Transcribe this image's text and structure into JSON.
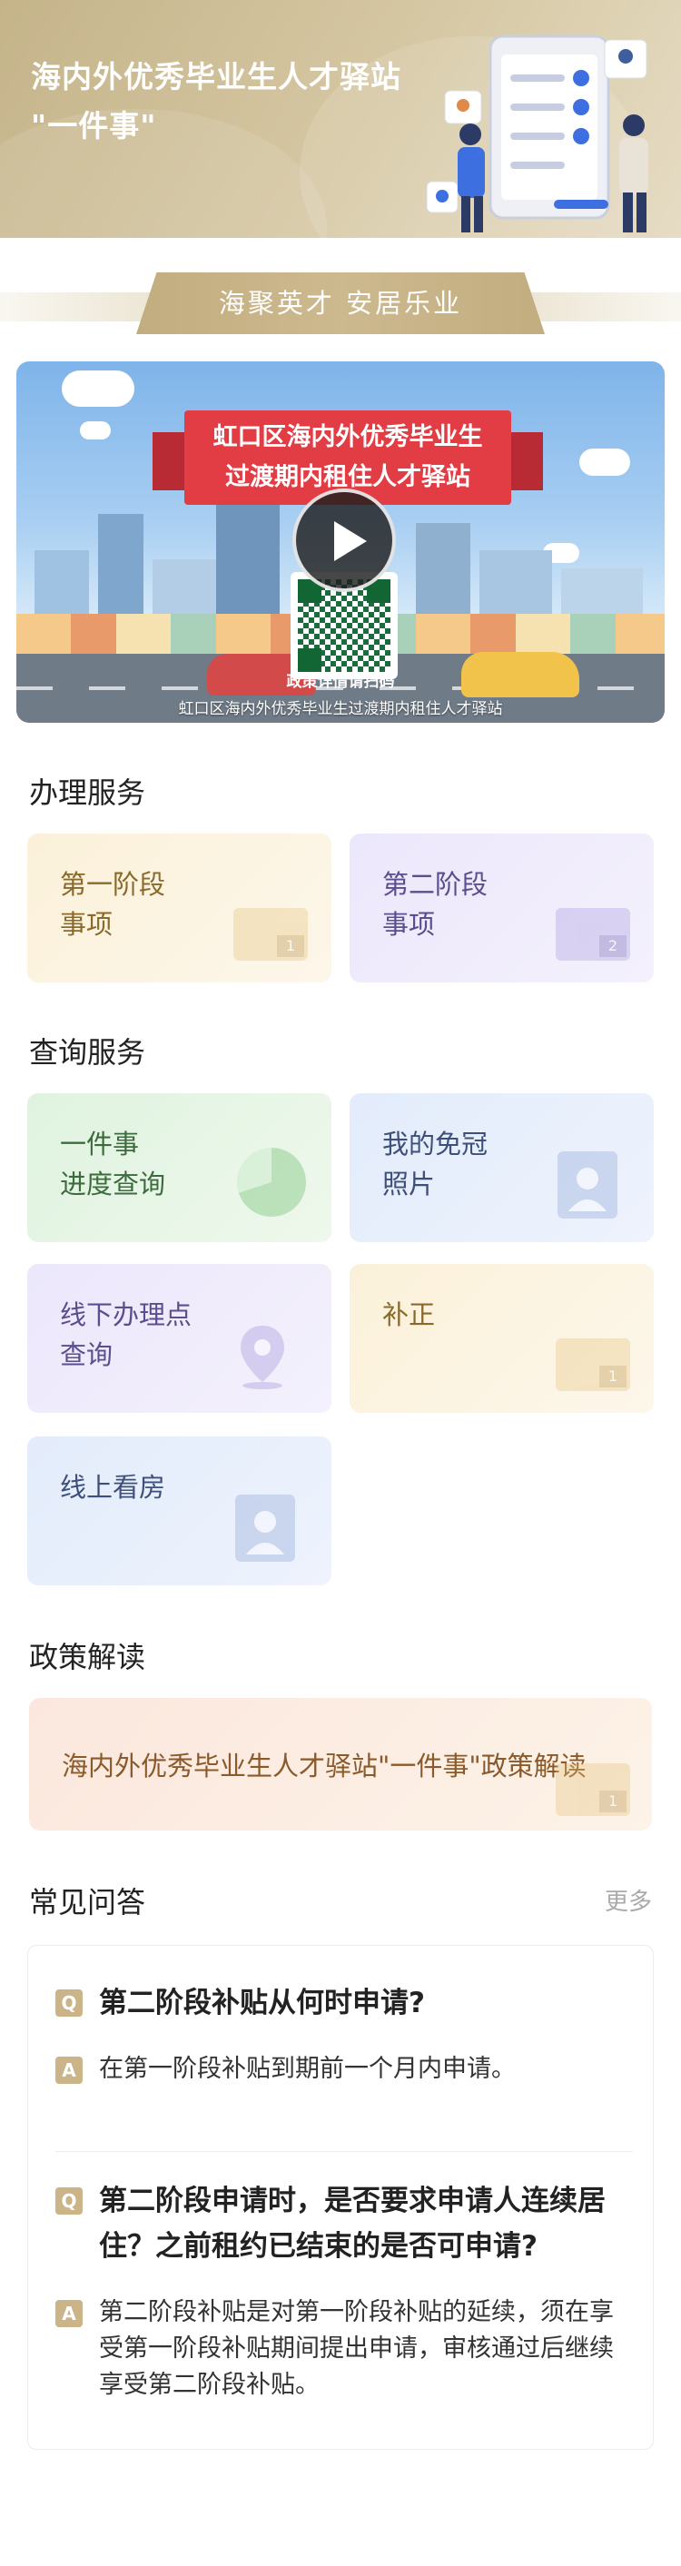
{
  "hero": {
    "title": "海内外优秀毕业生人才驿站\n\"一件事\""
  },
  "slogan": "海聚英才  安居乐业",
  "video": {
    "banner_line1": "虹口区海内外优秀毕业生",
    "banner_line2": "过渡期内租住人才驿站",
    "qr_caption": "政策详情请扫码",
    "caption": "虹口区海内外优秀毕业生过渡期内租住人才驿站"
  },
  "sections": {
    "handle_title": "办理服务",
    "query_title": "查询服务",
    "policy_title": "政策解读",
    "faq_title": "常见问答",
    "faq_more": "更多"
  },
  "handle_cards": [
    {
      "label": "第一阶段\n事项",
      "badge": "1"
    },
    {
      "label": "第二阶段\n事项",
      "badge": "2"
    }
  ],
  "query_cards": [
    {
      "label": "一件事\n进度查询"
    },
    {
      "label": "我的免冠\n照片"
    },
    {
      "label": "线下办理点\n查询"
    },
    {
      "label": "补正",
      "badge": "1"
    },
    {
      "label": "线上看房"
    }
  ],
  "policy_card": {
    "label": "海内外优秀毕业生人才驿站\"一件事\"政策解读",
    "badge": "1"
  },
  "faq": [
    {
      "q_tag": "Q",
      "question": "第二阶段补贴从何时申请?",
      "a_tag": "A",
      "answer": "在第一阶段补贴到期前一个月内申请。"
    },
    {
      "q_tag": "Q",
      "question": "第二阶段申请时，是否要求申请人连续居住？之前租约已结束的是否可申请?",
      "a_tag": "A",
      "answer": "第二阶段补贴是对第一阶段补贴的延续，须在享受第一阶段补贴期间提出申请，审核通过后继续享受第二阶段补贴。"
    }
  ],
  "colors": {
    "hero_gold": "#c5b48a",
    "tag_gold": "#cbb487",
    "banner_red": "#e23c45"
  }
}
